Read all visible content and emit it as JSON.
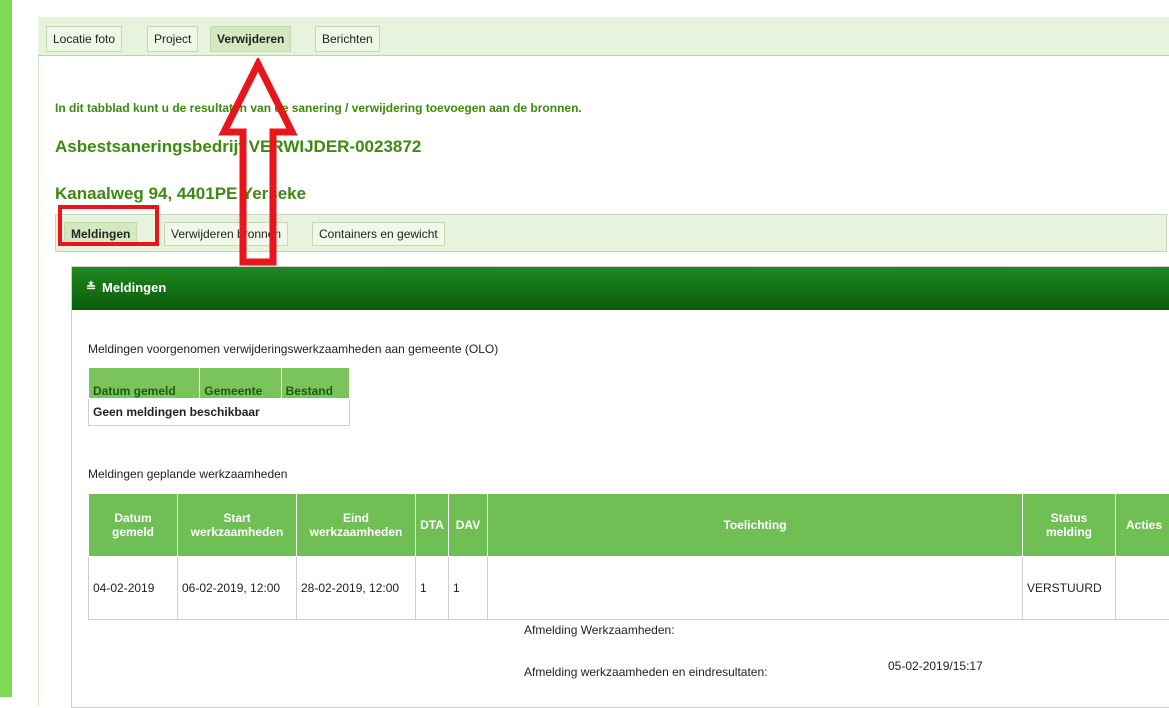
{
  "top_tabs": [
    "Locatie foto",
    "Project",
    "Verwijderen",
    "Berichten"
  ],
  "intro": "In dit tabblad kunt u de resultaten van de sanering / verwijdering toevoegen aan de bronnen.",
  "heading1": "Asbestsaneringsbedrijf VERWIJDER-0023872",
  "heading2": "Kanaalweg 94, 4401PE Yerseke",
  "sub_tabs": [
    "Meldingen",
    "Verwijderen bronnen",
    "Containers en gewicht"
  ],
  "panel_title": "Meldingen",
  "section1_label": "Meldingen voorgenomen verwijderingswerkzaamheden aan gemeente (OLO)",
  "table1": {
    "headers": [
      "Datum gemeld",
      "Gemeente",
      "Bestand"
    ],
    "empty": "Geen meldingen beschikbaar"
  },
  "section2_label": "Meldingen geplande werkzaamheden",
  "table2": {
    "headers": [
      "Datum gemeld",
      "Start werkzaamheden",
      "Eind werkzaamheden",
      "DTA",
      "DAV",
      "Toelichting",
      "Status melding",
      "Acties"
    ],
    "row": [
      "04-02-2019",
      "06-02-2019, 12:00",
      "28-02-2019, 12:00",
      "1",
      "1",
      "",
      "VERSTUURD",
      ""
    ]
  },
  "afmelding1": "Afmelding Werkzaamheden:",
  "afmelding2": "Afmelding werkzaamheden en eindresultaten:",
  "afmelding_date": "05-02-2019/15:17",
  "colors": {
    "accent_green": "#3c8a10",
    "header_green": "#0b5a0b",
    "annotation_red": "#e8151b"
  }
}
